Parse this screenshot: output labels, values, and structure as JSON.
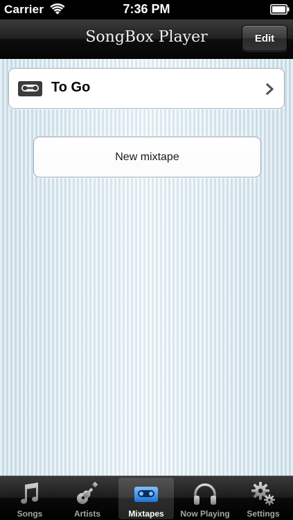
{
  "status_bar": {
    "carrier": "Carrier",
    "time": "7:36 PM",
    "icons": [
      "wifi-icon",
      "battery-icon"
    ]
  },
  "nav_bar": {
    "title": "SongBox Player",
    "edit_label": "Edit"
  },
  "list": {
    "items": [
      {
        "label": "To Go",
        "icon": "cassette-icon"
      }
    ]
  },
  "new_mixtape_label": "New mixtape",
  "tab_bar": {
    "tabs": [
      {
        "label": "Songs",
        "icon": "music-note-icon",
        "selected": false
      },
      {
        "label": "Artists",
        "icon": "guitar-icon",
        "selected": false
      },
      {
        "label": "Mixtapes",
        "icon": "cassette-icon",
        "selected": true
      },
      {
        "label": "Now Playing",
        "icon": "headphones-icon",
        "selected": false
      },
      {
        "label": "Settings",
        "icon": "gears-icon",
        "selected": false
      }
    ]
  },
  "colors": {
    "selected_tab_icon": "#3d8fe0",
    "content_background": "#d9e8f0"
  }
}
